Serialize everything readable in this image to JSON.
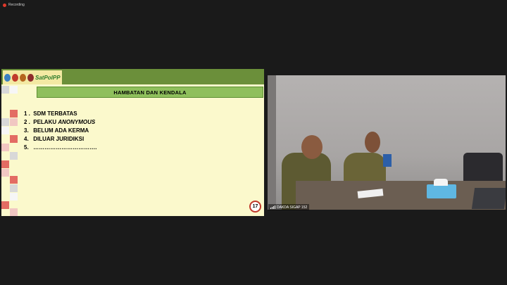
{
  "recording": {
    "label": "Recording"
  },
  "slide": {
    "brand": "SatPolPP",
    "title": "HAMBATAN DAN KENDALA",
    "items": [
      {
        "num": "1 .",
        "text": "SDM TERBATAS",
        "emphasis": ""
      },
      {
        "num": "2 .",
        "text": "PELAKU ",
        "emphasis": "ANONYMOUS"
      },
      {
        "num": "3.",
        "text": "BELUM ADA KERMA",
        "emphasis": ""
      },
      {
        "num": "4.",
        "text": "DILUAR JURIDIKSI",
        "emphasis": ""
      },
      {
        "num": "5.",
        "text": "…………………………….",
        "emphasis": ""
      }
    ],
    "page_number": "17"
  },
  "video": {
    "participant_name": "DAKDA SIGAP 152"
  },
  "colors": {
    "background": "#1a1a1a",
    "slide_bg": "#fbf9cc",
    "title_bar": "#8fbf5c",
    "record_dot": "#e0392b",
    "accent_red": "#e36c63"
  }
}
